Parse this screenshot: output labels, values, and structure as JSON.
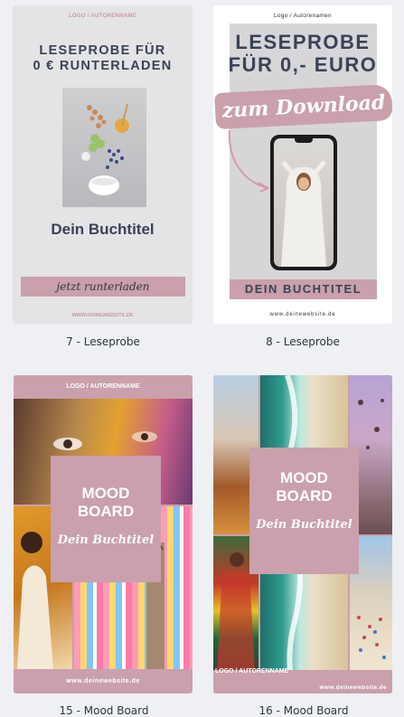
{
  "templates": [
    {
      "caption": "7 - Leseprobe",
      "logo": "LOGO / AUTORENNAME",
      "headline_1": "LESEPROBE FÜR",
      "headline_2": "0 € RUNTERLADEN",
      "title": "Dein Buchtitel",
      "cta": "jetzt runterladen",
      "website": "WWW.DEINEWEBSITE.DE"
    },
    {
      "caption": "8 - Leseprobe",
      "logo": "Logo / Autorenamen",
      "headline_1": "LESEPROBE",
      "headline_2": "FÜR 0,- EURO",
      "cta": "zum Download",
      "title": "DEIN BUCHTITEL",
      "website": "www.deinewebsite.de"
    },
    {
      "caption": "15 - Mood Board",
      "logo": "LOGO / AUTORENNAME",
      "headline_1": "MOOD",
      "headline_2": "BOARD",
      "title": "Dein Buchtitel",
      "website": "www.deinewebsite.de"
    },
    {
      "caption": "16 - Mood Board",
      "logo": "LOGO / AUTORENNAME",
      "headline_1": "MOOD",
      "headline_2": "BOARD",
      "title": "Dein Buchtitel",
      "website": "www.deinewebsite.de"
    }
  ],
  "colors": {
    "page_bg": "#eef0f4",
    "accent_pink": "#c9a0ab",
    "navy_text": "#3a4256"
  }
}
